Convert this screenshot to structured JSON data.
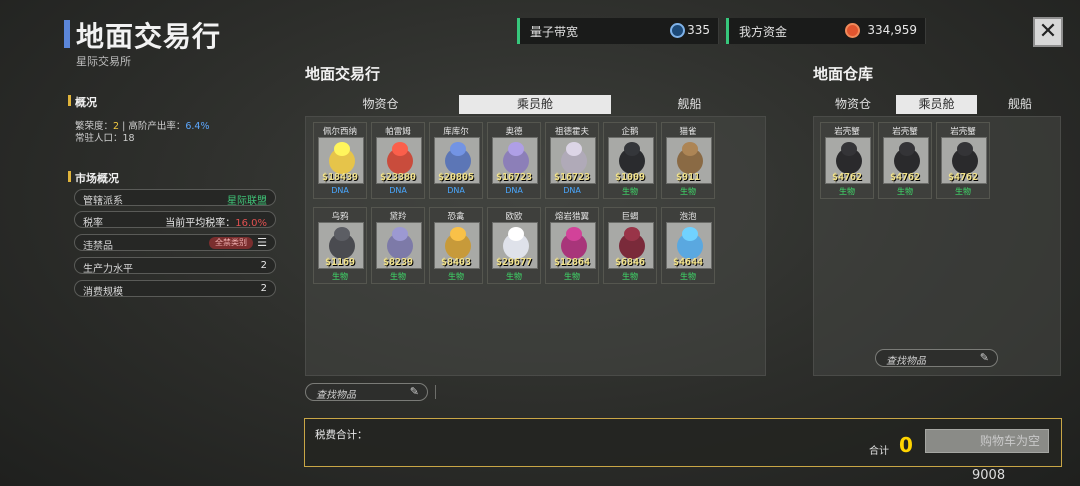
{
  "header": {
    "title": "地面交易行",
    "subtitle": "星际交易所",
    "resources": [
      {
        "label": "量子带宽",
        "value": "335",
        "icon": "quantum-icon",
        "color": "#7fb2e8"
      },
      {
        "label": "我方资金",
        "value": "334,959",
        "icon": "funds-icon",
        "color": "#e0552f"
      }
    ],
    "close_label": "✕"
  },
  "overview": {
    "title": "概况",
    "prosperity_label": "繁荣度：",
    "prosperity_value": "2",
    "output_label": "高阶产出率：",
    "output_value": "6.4%",
    "population_label": "常驻人口：",
    "population_value": "18"
  },
  "market_overview": {
    "title": "市场概况",
    "rows": [
      {
        "label": "管辖派系",
        "value": "星际联盟",
        "value_color": "#3fc478"
      },
      {
        "label": "税率",
        "mid": "当前平均税率：",
        "value": "16.0%",
        "value_color": "#e05050"
      },
      {
        "label": "违禁品",
        "badge": "全禁类别",
        "icon": "list-icon"
      },
      {
        "label": "生产力水平",
        "value": "2"
      },
      {
        "label": "消费规模",
        "value": "2"
      }
    ]
  },
  "market": {
    "title": "地面交易行",
    "tabs": [
      "物资仓",
      "乘员舱",
      "舰船"
    ],
    "active_tab": 1,
    "items": [
      {
        "name": "佩尔西纳",
        "price": "$18439",
        "tag": "DNA",
        "art": "#e6c44a"
      },
      {
        "name": "帕雷姆",
        "price": "$23380",
        "tag": "DNA",
        "art": "#c94c3c"
      },
      {
        "name": "库库尔",
        "price": "$20805",
        "tag": "DNA",
        "art": "#5c76b6"
      },
      {
        "name": "奥德",
        "price": "$16723",
        "tag": "DNA",
        "art": "#8c7fb8"
      },
      {
        "name": "祖德霍夫",
        "price": "$16723",
        "tag": "DNA",
        "art": "#b0aab8"
      },
      {
        "name": "企鹅",
        "price": "$1009",
        "tag": "生物",
        "art": "#2a2b2e"
      },
      {
        "name": "猫雀",
        "price": "$911",
        "tag": "生物",
        "art": "#8a6a44"
      },
      {
        "name": "乌鸦",
        "price": "$1169",
        "tag": "生物",
        "art": "#4a4b50"
      },
      {
        "name": "黛羚",
        "price": "$8239",
        "tag": "生物",
        "art": "#7d7aa8"
      },
      {
        "name": "恐禽",
        "price": "$8403",
        "tag": "生物",
        "art": "#c79a3a"
      },
      {
        "name": "欧欧",
        "price": "$29677",
        "tag": "生物",
        "art": "#dfe2ea"
      },
      {
        "name": "熔岩猎翼",
        "price": "$12864",
        "tag": "生物",
        "art": "#a8357a"
      },
      {
        "name": "巨蝎",
        "price": "$6846",
        "tag": "生物",
        "art": "#7a2a3a"
      },
      {
        "name": "泡泡",
        "price": "$4644",
        "tag": "生物",
        "art": "#5aa8e0"
      }
    ],
    "search_placeholder": "查找物品"
  },
  "warehouse": {
    "title": "地面仓库",
    "tabs": [
      "物资仓",
      "乘员舱",
      "舰船"
    ],
    "active_tab": 1,
    "items": [
      {
        "name": "岩壳蟹",
        "price": "$4762",
        "tag": "生物",
        "art": "#2a2a2c"
      },
      {
        "name": "岩壳蟹",
        "price": "$4762",
        "tag": "生物",
        "art": "#2a2a2c"
      },
      {
        "name": "岩壳蟹",
        "price": "$4762",
        "tag": "生物",
        "art": "#2a2a2c"
      }
    ],
    "search_placeholder": "查找物品"
  },
  "footer": {
    "tax_label": "税费合计：",
    "total_label": "合计",
    "total_value": "0",
    "cart_button": "购物车为空",
    "code": "9008"
  },
  "colors": {
    "dna": "#4aa8ff",
    "bio": "#3fdc6a",
    "accent": "#e0b43b"
  }
}
